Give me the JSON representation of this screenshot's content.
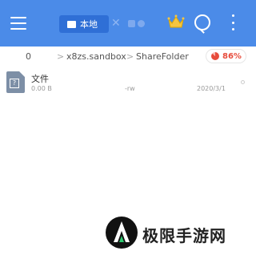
{
  "topbar": {
    "tab_label": "本地",
    "close_symbol": "✕",
    "bg_color": "#4b8be8",
    "active_tab_color": "#2f6fd6"
  },
  "breadcrumb": {
    "items": [
      "0",
      "x8zs.sandbox",
      "ShareFolder"
    ],
    "separator": ">"
  },
  "storage": {
    "usage": "86%",
    "accent_color": "#e74c3c"
  },
  "files": [
    {
      "name": "文件",
      "size": "0.00 B",
      "permissions": "-rw",
      "date": "2020/3/1"
    }
  ],
  "watermark": {
    "text": "极限手游网"
  }
}
